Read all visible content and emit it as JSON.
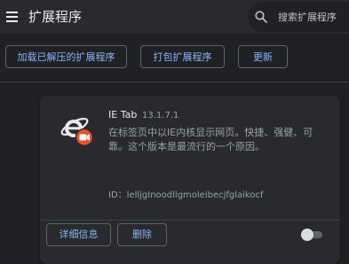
{
  "header": {
    "title": "扩展程序",
    "menu_icon": "hamburger-menu-icon",
    "search": {
      "placeholder": "搜索扩展程序",
      "icon": "search-icon"
    }
  },
  "toolbar": {
    "load_unpacked_label": "加载已解压的扩展程序",
    "pack_label": "打包扩展程序",
    "update_label": "更新"
  },
  "extension": {
    "name": "IE Tab",
    "version": "13.1.7.1",
    "description": "在标签页中以IE内核显示网页。快捷、强健、可靠。这个版本是最流行的一个原因。",
    "id_text": "ID：lelljgInoodllgmoleibecjfglaikocf",
    "icon": "ie-tab-logo-icon",
    "details_label": "详细信息",
    "remove_label": "删除",
    "enabled": false
  },
  "colors": {
    "background": "#202124",
    "surface": "#292a2d",
    "accent": "#8ab4f8",
    "text_primary": "#e8eaed",
    "text_secondary": "#9aa0a6",
    "border": "#5f6368",
    "icon_badge": "#e8542a"
  }
}
